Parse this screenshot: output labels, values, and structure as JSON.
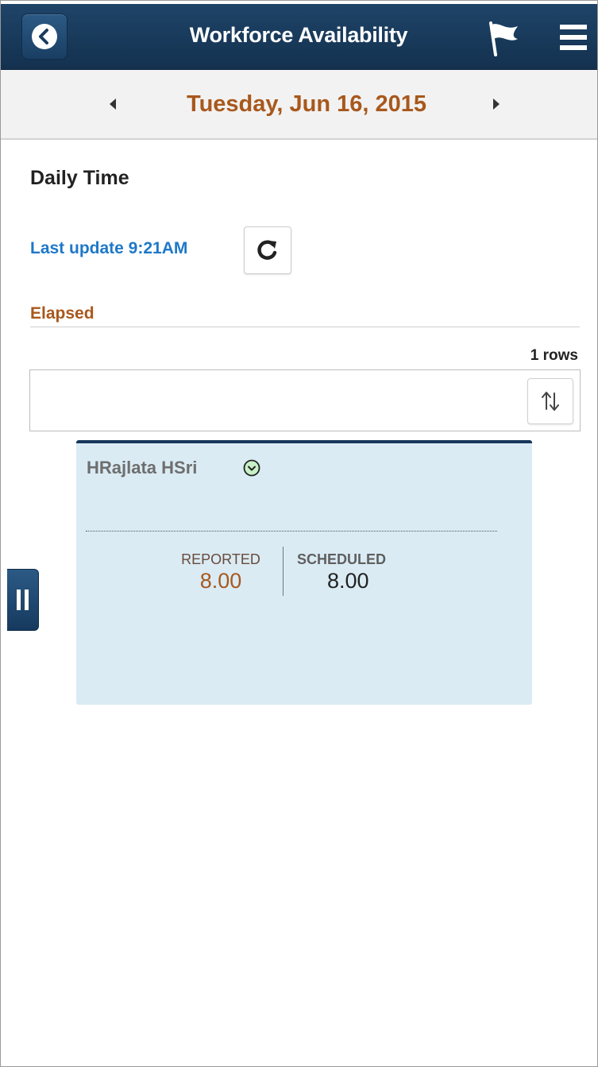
{
  "header": {
    "title": "Workforce Availability",
    "back_icon": "chevron-left-icon",
    "flag_icon": "flag-icon",
    "menu_icon": "hamburger-menu-icon"
  },
  "date_bar": {
    "date": "Tuesday, Jun 16, 2015",
    "prev_icon": "caret-left-icon",
    "next_icon": "caret-right-icon"
  },
  "content": {
    "section_title": "Daily Time",
    "last_update": "Last update 9:21AM",
    "refresh_icon": "refresh-icon",
    "group_label": "Elapsed",
    "rows_count": "1 rows",
    "sort_icon": "sort-icon"
  },
  "card": {
    "employee_name": "HRajlata HSri",
    "expand_icon": "chevron-down-circle-icon",
    "reported_label": "REPORTED",
    "reported_value": "8.00",
    "scheduled_label": "SCHEDULED",
    "scheduled_value": "8.00"
  },
  "colors": {
    "header_bg": "#1b3c5e",
    "accent_orange": "#a8581c",
    "link_blue": "#1e78c8",
    "card_bg": "#daebf4"
  }
}
